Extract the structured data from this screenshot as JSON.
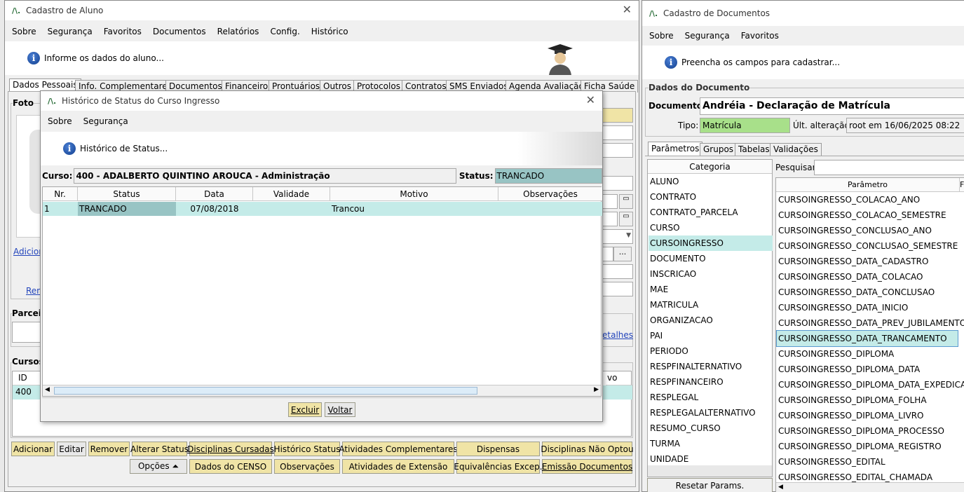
{
  "main_window": {
    "title": "Cadastro de Aluno",
    "menu": [
      "Sobre",
      "Segurança",
      "Favoritos",
      "Documentos",
      "Relatórios",
      "Config.",
      "Histórico"
    ],
    "info": "Informe os dados do aluno...",
    "tabs": [
      "Dados Pessoais",
      "Info. Complementares",
      "Documentos",
      "Financeiro",
      "Prontuários",
      "Outros",
      "Protocolos",
      "Contratos",
      "SMS Enviados",
      "Agenda Avaliação",
      "Ficha Saúde"
    ],
    "foto_label": "Foto",
    "adicionar_link": "Adicior",
    "ren_link": "Ren",
    "parceiro_label": "Parceir",
    "detalhes_link": "etalhes",
    "cursos_label": "Cursos",
    "cursos_header_id": "ID",
    "cursos_header_vo": "vo",
    "cursos_row_id": "400",
    "buttons_row1": [
      "Adicionar",
      "Editar",
      "Remover",
      "Alterar Status",
      "Disciplinas Cursadas",
      "Histórico Status",
      "Atividades Complementares",
      "Dispensas",
      "Disciplinas Não Optou"
    ],
    "buttons_row2": [
      "Opções ⏶",
      "Dados do CENSO",
      "Observações",
      "Atividades de Extensão",
      "Equivalências Excep.",
      "Emissão Documentos"
    ]
  },
  "dialog": {
    "title": "Histórico de Status do Curso Ingresso",
    "menu": [
      "Sobre",
      "Segurança"
    ],
    "info": "Histórico de Status...",
    "curso_label": "Curso:",
    "curso_value": "400 - ADALBERTO QUINTINO AROUCA - Administração",
    "status_label": "Status:",
    "status_value": "TRANCADO",
    "columns": [
      "Nr.",
      "Status",
      "Data",
      "Validade",
      "Motivo",
      "Observações"
    ],
    "rows": [
      {
        "nr": "1",
        "status": "TRANCADO",
        "data": "07/08/2018",
        "validade": "",
        "motivo": "Trancou",
        "obs": ""
      }
    ],
    "btn_excluir": "Excluir",
    "btn_voltar": "Voltar"
  },
  "docs_window": {
    "title": "Cadastro de Documentos",
    "menu": [
      "Sobre",
      "Segurança",
      "Favoritos"
    ],
    "info": "Preencha os campos para cadastrar...",
    "group_label": "Dados do Documento",
    "documento_label": "Documento:",
    "documento_value": "Andréia - Declaração de Matrícula",
    "tipo_label": "Tipo:",
    "tipo_value": "Matrícula",
    "ult_label": "Últ. alteração:",
    "ult_value": "root em 16/06/2025 08:22",
    "tabs": [
      "Parâmetros",
      "Grupos",
      "Tabelas",
      "Validações"
    ],
    "categoria_header": "Categoria",
    "categorias": [
      "ALUNO",
      "CONTRATO",
      "CONTRATO_PARCELA",
      "CURSO",
      "CURSOINGRESSO",
      "DOCUMENTO",
      "INSCRICAO",
      "MAE",
      "MATRICULA",
      "ORGANIZACAO",
      "PAI",
      "PERIODO",
      "RESPFINALTERNATIVO",
      "RESPFINANCEIRO",
      "RESPLEGAL",
      "RESPLEGALALTERNATIVO",
      "RESUMO_CURSO",
      "TURMA",
      "UNIDADE"
    ],
    "selected_categoria": "CURSOINGRESSO",
    "pesquisar_label": "Pesquisar:",
    "parametro_header": "Parâmetro",
    "parametro_header2": "F",
    "parametros": [
      "CURSOINGRESSO_COLACAO_ANO",
      "CURSOINGRESSO_COLACAO_SEMESTRE",
      "CURSOINGRESSO_CONCLUSAO_ANO",
      "CURSOINGRESSO_CONCLUSAO_SEMESTRE",
      "CURSOINGRESSO_DATA_CADASTRO",
      "CURSOINGRESSO_DATA_COLACAO",
      "CURSOINGRESSO_DATA_CONCLUSAO",
      "CURSOINGRESSO_DATA_INICIO",
      "CURSOINGRESSO_DATA_PREV_JUBILAMENTO",
      "CURSOINGRESSO_DATA_TRANCAMENTO",
      "CURSOINGRESSO_DIPLOMA",
      "CURSOINGRESSO_DIPLOMA_DATA",
      "CURSOINGRESSO_DIPLOMA_DATA_EXPEDICAO",
      "CURSOINGRESSO_DIPLOMA_FOLHA",
      "CURSOINGRESSO_DIPLOMA_LIVRO",
      "CURSOINGRESSO_DIPLOMA_PROCESSO",
      "CURSOINGRESSO_DIPLOMA_REGISTRO",
      "CURSOINGRESSO_EDITAL",
      "CURSOINGRESSO_EDITAL_CHAMADA"
    ],
    "selected_parametro": "CURSOINGRESSO_DATA_TRANCAMENTO",
    "resetar_button": "Resetar Params."
  }
}
